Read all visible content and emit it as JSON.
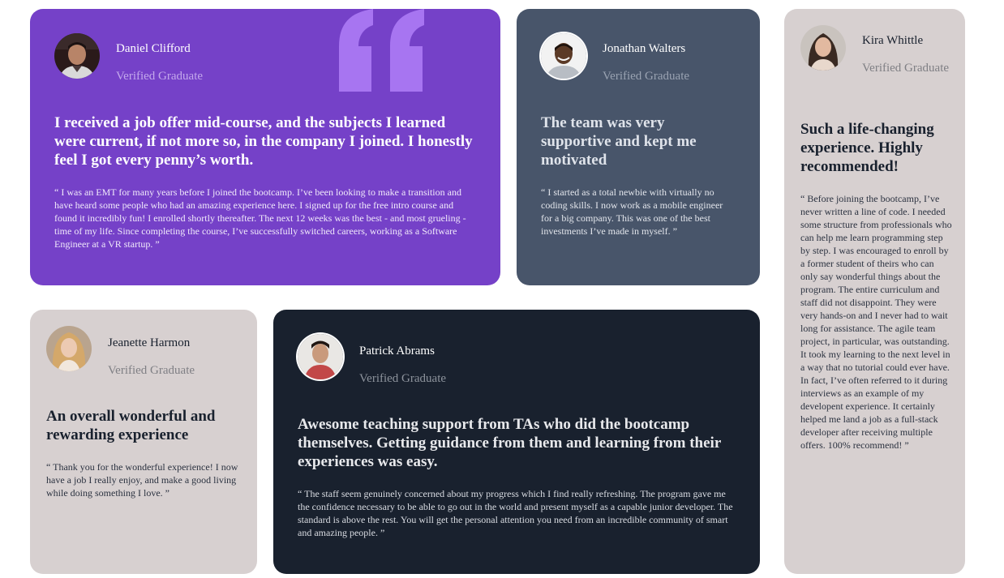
{
  "colors": {
    "violet": "#7541c8",
    "grayish_blue": "#48556a",
    "light_gray": "#d7d0d0",
    "blackish_blue": "#19212e",
    "quote_mark": "#a775f1",
    "white": "#ffffff"
  },
  "testimonials": [
    {
      "name": "Daniel Clifford",
      "role": "Verified Graduate",
      "headline": "I received a job offer mid-course, and the subjects I learned were current, if not more so, in the company I joined. I honestly feel I got every penny’s worth.",
      "body": "“ I was an EMT for many years before I joined the bootcamp. I’ve been looking to make a transition and have heard some people who had an amazing experience here. I signed up for the free intro course and found it incredibly fun! I enrolled shortly thereafter. The next 12 weeks was the best - and most grueling - time of my life. Since completing the course, I’ve successfully switched careers, working as a Software Engineer at a VR startup. ”",
      "avatar_icon": "avatar-photo-icon"
    },
    {
      "name": "Jonathan Walters",
      "role": "Verified Graduate",
      "headline": "The team was very supportive and kept me motivated",
      "body": "“ I started as a total newbie with virtually no coding skills. I now work as a mobile engineer for a big company. This was one of the best investments I’ve made in myself. ”",
      "avatar_icon": "avatar-photo-icon"
    },
    {
      "name": "Kira Whittle",
      "role": "Verified Graduate",
      "headline": "Such a life-changing experience. Highly recommended!",
      "body": "“ Before joining the bootcamp, I’ve never written a line of code. I needed some structure from professionals who can help me learn programming step by step. I was encouraged to enroll by a former student of theirs who can only say wonderful things about the program. The entire curriculum and staff did not disappoint. They were very hands-on and I never had to wait long for assistance. The agile team project, in particular, was outstanding. It took my learning to the next level in a way that no tutorial could ever have. In fact, I’ve often referred to it during interviews as an example of my developent experience. It certainly helped me land a job as a full-stack developer after receiving multiple offers. 100% recommend! ”",
      "avatar_icon": "avatar-photo-icon"
    },
    {
      "name": "Jeanette Harmon",
      "role": "Verified Graduate",
      "headline": "An overall wonderful and rewarding experience",
      "body": "“ Thank you for the wonderful experience! I now have a job I really enjoy, and make a good living while doing something I love. ”",
      "avatar_icon": "avatar-photo-icon"
    },
    {
      "name": "Patrick Abrams",
      "role": "Verified Graduate",
      "headline": "Awesome teaching support from TAs who did the bootcamp themselves. Getting guidance from them and learning from their experiences was easy.",
      "body": "“ The staff seem genuinely concerned about my progress which I find really refreshing. The program gave me the confidence necessary to be able to go out in the world and present myself as a capable junior developer. The standard is above the rest. You will get the personal attention you need from an incredible community of smart and amazing people. ”",
      "avatar_icon": "avatar-photo-icon"
    }
  ],
  "decorations": {
    "quote_icon": "quotation-mark-icon"
  }
}
